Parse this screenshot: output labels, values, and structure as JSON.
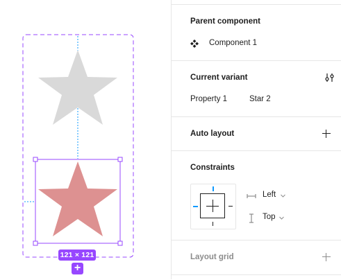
{
  "canvas": {
    "size_badge": "121 × 121",
    "add_variant_label": "+",
    "colors": {
      "frame": "#9747ff",
      "star_default": "#d9d9d9",
      "star_variant": "#dd9191",
      "guide": "#0d99ff"
    }
  },
  "panel": {
    "parent_component": {
      "title": "Parent component",
      "component_name": "Component 1",
      "icon": "component-icon"
    },
    "current_variant": {
      "title": "Current variant",
      "property_name": "Property 1",
      "property_value": "Star 2",
      "icon": "tune-icon"
    },
    "auto_layout": {
      "title": "Auto layout",
      "icon": "plus-icon"
    },
    "constraints": {
      "title": "Constraints",
      "horizontal": "Left",
      "vertical": "Top",
      "colors": {
        "active": "#0d99ff"
      }
    },
    "layout_grid": {
      "title": "Layout grid",
      "icon": "plus-icon"
    }
  }
}
